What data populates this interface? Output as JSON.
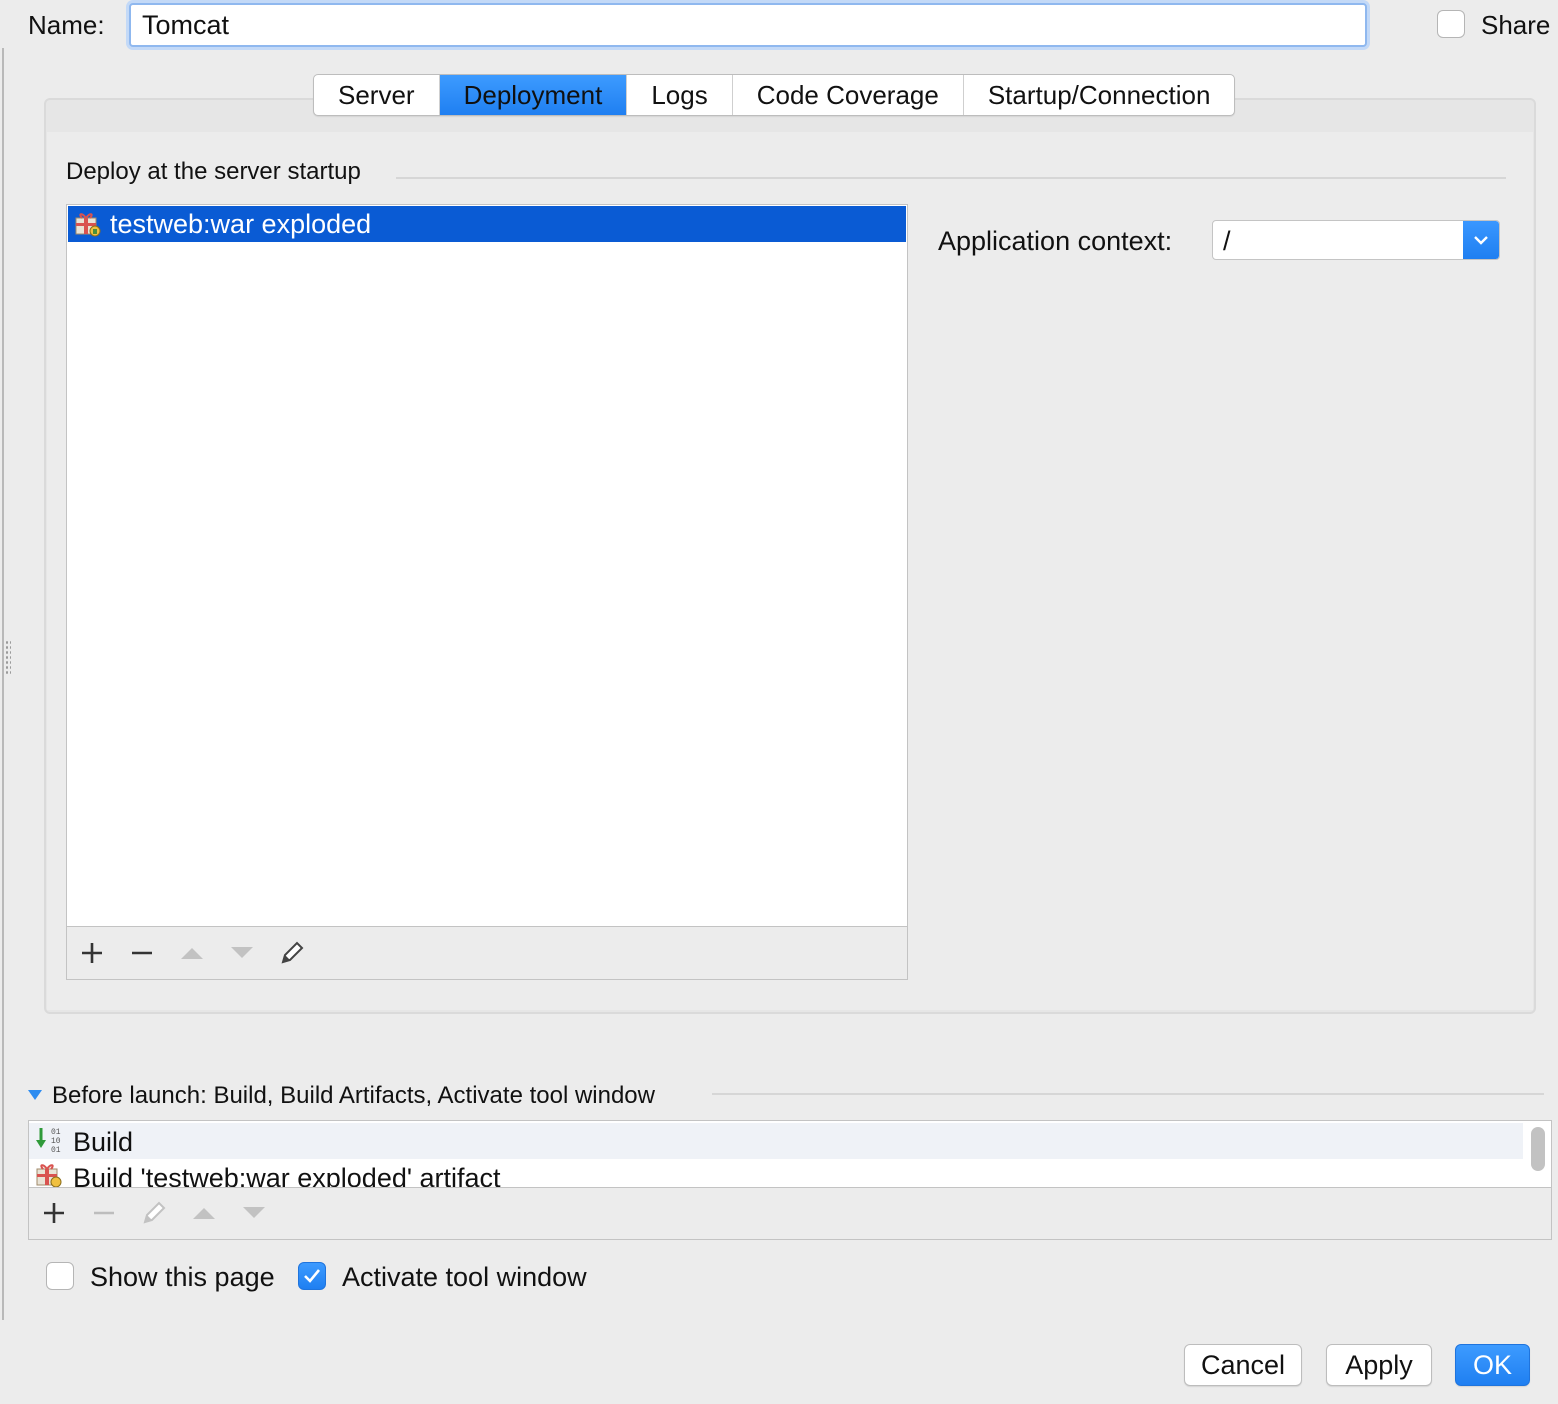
{
  "header": {
    "name_label": "Name:",
    "name_value": "Tomcat",
    "share_label": "Share",
    "share_checked": false
  },
  "tabs": [
    {
      "label": "Server",
      "active": false
    },
    {
      "label": "Deployment",
      "active": true
    },
    {
      "label": "Logs",
      "active": false
    },
    {
      "label": "Code Coverage",
      "active": false
    },
    {
      "label": "Startup/Connection",
      "active": false
    }
  ],
  "deployment": {
    "section_title": "Deploy at the server startup",
    "items": [
      {
        "label": "testweb:war exploded",
        "icon": "artifact-icon",
        "selected": true
      }
    ],
    "toolbar": [
      "add-icon",
      "remove-icon",
      "move-up-icon",
      "move-down-icon",
      "edit-icon"
    ],
    "app_context_label": "Application context:",
    "app_context_value": "/"
  },
  "before_launch": {
    "title": "Before launch: Build, Build Artifacts, Activate tool window",
    "items": [
      {
        "label": "Build",
        "icon": "build-icon"
      },
      {
        "label": "Build 'testweb:war exploded' artifact",
        "icon": "artifact-icon"
      }
    ],
    "toolbar": [
      "add-icon",
      "remove-icon",
      "edit-icon",
      "move-up-icon",
      "move-down-icon"
    ]
  },
  "options": {
    "show_page_label": "Show this page",
    "show_page_checked": false,
    "activate_tool_label": "Activate tool window",
    "activate_tool_checked": true
  },
  "buttons": {
    "cancel": "Cancel",
    "apply": "Apply",
    "ok": "OK"
  },
  "colors": {
    "accent": "#1f7ff1",
    "selection": "#0a5bd4",
    "background": "#ececec"
  }
}
